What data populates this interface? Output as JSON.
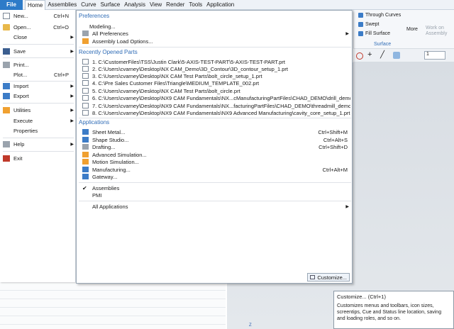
{
  "menubar": {
    "file": "File",
    "items": [
      "Home",
      "Assemblies",
      "Curve",
      "Surface",
      "Analysis",
      "View",
      "Render",
      "Tools",
      "Application"
    ]
  },
  "ribbon": {
    "through_curves": "Through Curves",
    "swept": "Swept",
    "fill_surface": "Fill Surface",
    "more": "More",
    "surface_group": "Surface",
    "work_on_assembly": "Work on Assembly",
    "combo_value": "1"
  },
  "file_menu": [
    {
      "label": "New...",
      "shortcut": "Ctrl+N",
      "icon": "new-file-icon"
    },
    {
      "label": "Open...",
      "shortcut": "Ctrl+O",
      "icon": "open-folder-icon"
    },
    {
      "label": "Close",
      "shortcut": "",
      "icon": "",
      "arrow": true
    },
    {
      "label": "Save",
      "shortcut": "",
      "icon": "save-icon",
      "arrow": true
    },
    {
      "label": "Print...",
      "shortcut": "",
      "icon": "print-icon"
    },
    {
      "label": "Plot...",
      "shortcut": "Ctrl+P",
      "icon": ""
    },
    {
      "label": "Import",
      "shortcut": "",
      "icon": "import-icon",
      "arrow": true
    },
    {
      "label": "Export",
      "shortcut": "",
      "icon": "export-icon",
      "arrow": true
    },
    {
      "label": "Utilities",
      "shortcut": "",
      "icon": "utilities-icon",
      "arrow": true
    },
    {
      "label": "Execute",
      "shortcut": "",
      "icon": "",
      "arrow": true
    },
    {
      "label": "Properties",
      "shortcut": "",
      "icon": ""
    },
    {
      "label": "Help",
      "shortcut": "",
      "icon": "help-icon",
      "arrow": true
    },
    {
      "label": "Exit",
      "shortcut": "",
      "icon": "exit-icon"
    }
  ],
  "preferences": {
    "heading": "Preferences",
    "items": [
      {
        "label": "Modeling...",
        "arrow": false
      },
      {
        "label": "All Preferences",
        "arrow": true
      },
      {
        "label": "Assembly Load Options...",
        "arrow": false
      }
    ]
  },
  "recent": {
    "heading": "Recently Opened Parts",
    "items": [
      "1. C:\\CustomerFiles\\TSS\\Justin Clark\\5-AXIS-TEST-PART\\5-AXIS-TEST-PART.prt",
      "2. C:\\Users\\cvarney\\Desktop\\NX CAM_Demo\\3D_Contour\\3D_contour_setup_1.prt",
      "3. C:\\Users\\cvarney\\Desktop\\NX CAM Test Parts\\bolt_circle_setup_1.prt",
      "4. C:\\Pre Sales Customer Files\\Triangle\\MEDIUM_TEMPLATE_002.prt",
      "5. C:\\Users\\cvarney\\Desktop\\NX CAM Test Parts\\bolt_circle.prt",
      "6. C:\\Users\\cvarney\\Desktop\\NX9 CAM Fundamentals\\NX...cManufacturingPartFiles\\CHAD_DEMO\\drill_demo.prt",
      "7. C:\\Users\\cvarney\\Desktop\\NX9 CAM Fundamentals\\NX...facturingPartFiles\\CHAD_DEMO\\threadmill_demo.prt",
      "8. C:\\Users\\cvarney\\Desktop\\NX9 CAM Fundamentals\\NX9 Advanced Manufacturing\\cavity_core_setup_1.prt"
    ]
  },
  "applications": {
    "heading": "Applications",
    "items": [
      {
        "label": "Sheet Metal...",
        "shortcut": "Ctrl+Shift+M"
      },
      {
        "label": "Shape Studio...",
        "shortcut": "Ctrl+Alt+S"
      },
      {
        "label": "Drafting...",
        "shortcut": "Ctrl+Shift+D"
      },
      {
        "label": "Advanced Simulation...",
        "shortcut": ""
      },
      {
        "label": "Motion Simulation...",
        "shortcut": ""
      },
      {
        "label": "Manufacturing...",
        "shortcut": "Ctrl+Alt+M"
      },
      {
        "label": "Gateway...",
        "shortcut": ""
      }
    ],
    "assemblies": "Assemblies",
    "pmi": "PMI",
    "all_applications": "All Applications"
  },
  "customize_button": "Customize...",
  "tooltip": {
    "title": "Customize... (Ctrl+1)",
    "description": "Customizes menus and toolbars, icon sizes, screentips, Cue and Status line location, saving and loading roles, and so on."
  },
  "axis_label": "Z"
}
